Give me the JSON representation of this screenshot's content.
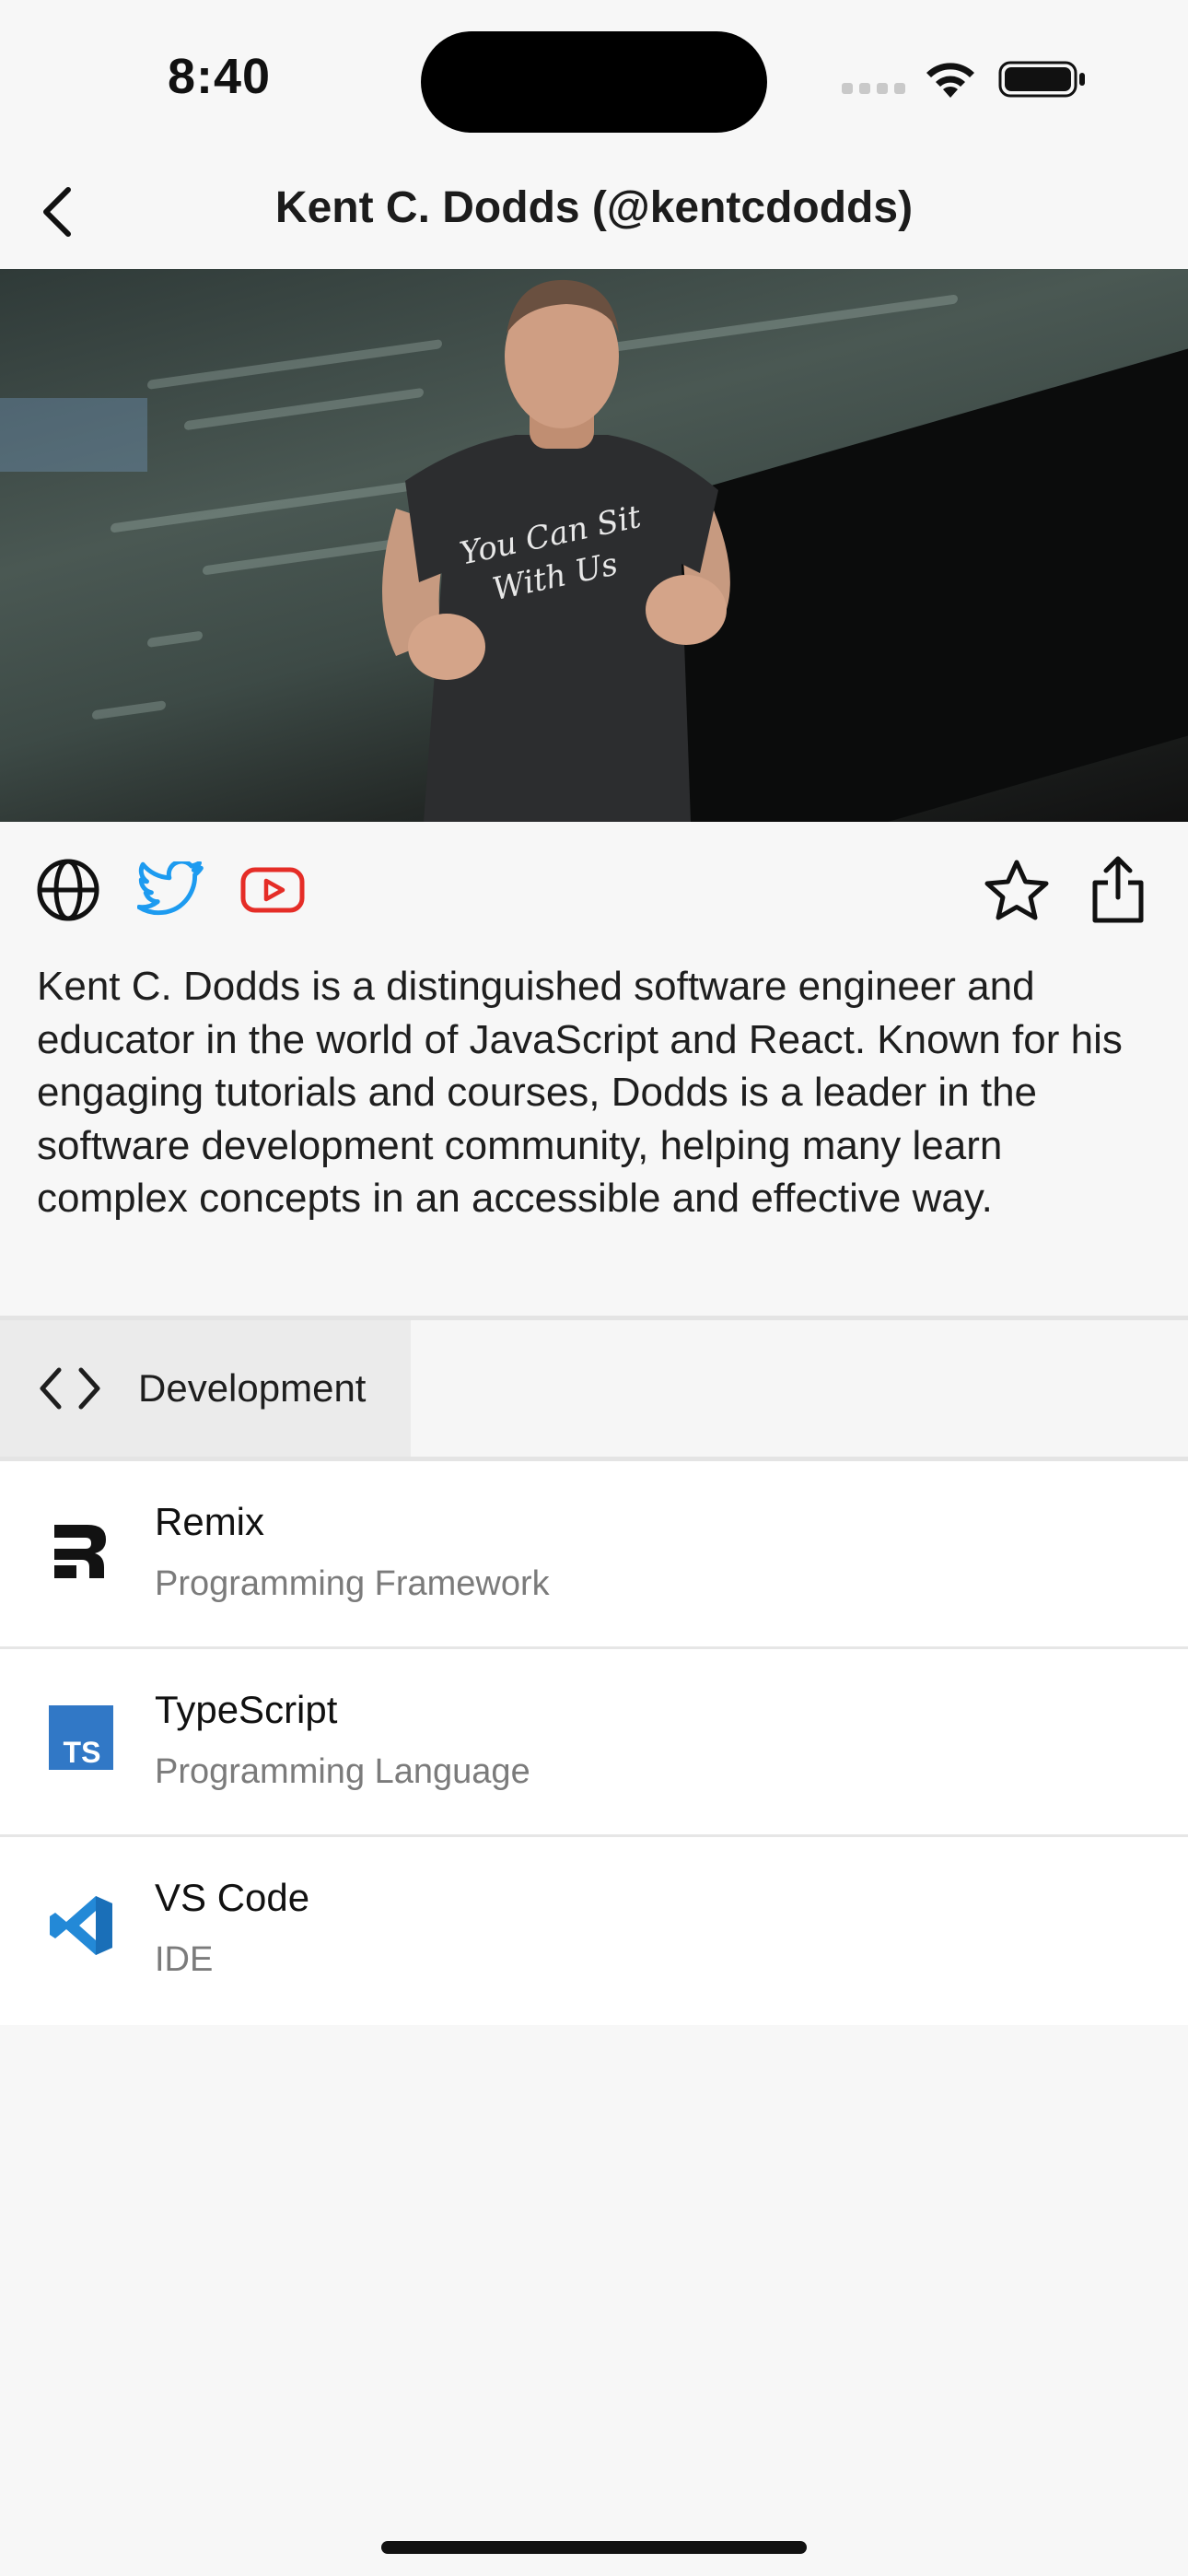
{
  "status_bar": {
    "time": "8:40"
  },
  "nav": {
    "title": "Kent C. Dodds (@kentcdodds)"
  },
  "hero": {
    "shirt_text_line1": "You Can Sit",
    "shirt_text_line2": "With Us"
  },
  "social": {
    "icons": [
      "globe-icon",
      "twitter-icon",
      "youtube-icon",
      "star-icon",
      "share-icon"
    ],
    "twitter_color": "#1d9bf0",
    "youtube_color": "#e52d27"
  },
  "bio": "Kent C. Dodds is a distinguished software engineer and educator in the world of JavaScript and React. Known for his engaging tutorials and courses, Dodds is a leader in the software development community, helping many learn complex concepts in an accessible and effective way.",
  "categories": [
    {
      "label": "Development",
      "icon": "code-icon",
      "selected": true
    }
  ],
  "tools": [
    {
      "name": "Remix",
      "type": "Programming Framework",
      "icon": "remix-logo-icon"
    },
    {
      "name": "TypeScript",
      "type": "Programming Language",
      "icon": "typescript-logo-icon",
      "color": "#3178c6"
    },
    {
      "name": "VS Code",
      "type": "IDE",
      "icon": "vscode-logo-icon",
      "color": "#2389d7"
    }
  ]
}
